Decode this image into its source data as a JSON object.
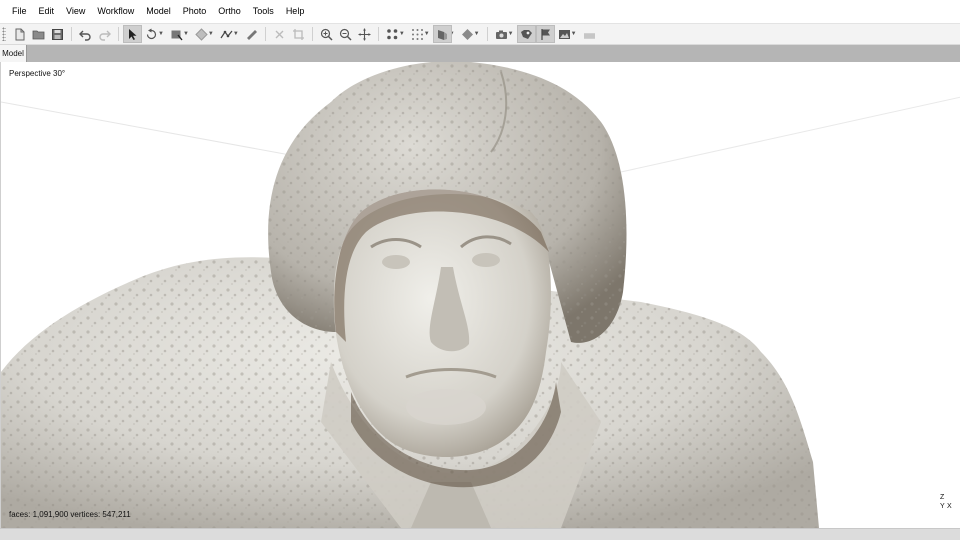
{
  "menu": [
    {
      "label": "File",
      "name": "menu-file"
    },
    {
      "label": "Edit",
      "name": "menu-edit"
    },
    {
      "label": "View",
      "name": "menu-view"
    },
    {
      "label": "Workflow",
      "name": "menu-workflow"
    },
    {
      "label": "Model",
      "name": "menu-model"
    },
    {
      "label": "Photo",
      "name": "menu-photo"
    },
    {
      "label": "Ortho",
      "name": "menu-ortho"
    },
    {
      "label": "Tools",
      "name": "menu-tools"
    },
    {
      "label": "Help",
      "name": "menu-help"
    }
  ],
  "toolbar": {
    "icons": [
      "new-document-icon",
      "open-folder-icon",
      "save-icon",
      "undo-icon",
      "redo-icon",
      "navigation-arrow-icon",
      "rotate-selection-icon",
      "rectangle-selection-icon",
      "volume-icon",
      "polyline-icon",
      "ruler-icon",
      "delete-selection-icon",
      "crop-icon",
      "zoom-in-icon",
      "zoom-out-icon",
      "move-object-icon",
      "point-cloud-icon",
      "grid-icon",
      "model-view-icon",
      "shaded-icon",
      "camera-icon",
      "show-markers-icon",
      "show-flags-icon",
      "image-view-icon",
      "layers-icon"
    ],
    "active": "navigation-arrow-icon"
  },
  "tabs": [
    {
      "label": "Model"
    }
  ],
  "viewport": {
    "projection_label": "Perspective 30°",
    "stats": "faces: 1,091,900 vertices: 547,211",
    "axes": {
      "z": "Z",
      "y": "Y",
      "x": "X"
    }
  },
  "colors": {
    "accent_active": "#cfcfcf",
    "viewport_bg": "#ffffff",
    "tab_bg": "#b5b5b5",
    "model_stone": "#d6d4ce",
    "model_shadow": "#5a4a3a"
  }
}
